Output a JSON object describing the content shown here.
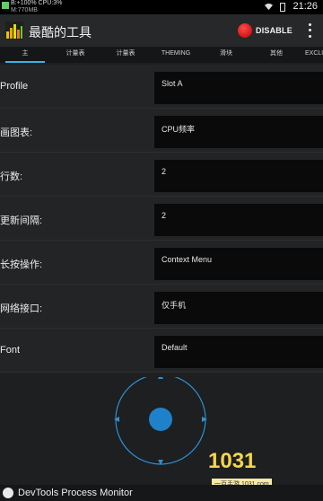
{
  "status_bar": {
    "cpu_text": "B:+100% CPU:3%",
    "mem_text": "M:770MB",
    "time": "21:26"
  },
  "action_bar": {
    "title": "最酷的工具",
    "disable_label": "DISABLE",
    "accent": "#33b5e5"
  },
  "tabs": [
    {
      "label": "主",
      "active": true
    },
    {
      "label": "计量表"
    },
    {
      "label": "计量表"
    },
    {
      "label": "THEMING"
    },
    {
      "label": "滑块"
    },
    {
      "label": "其他"
    },
    {
      "label": "EXCLUSI"
    }
  ],
  "settings": [
    {
      "label": "Profile",
      "value": "Slot A"
    },
    {
      "label": "画图表:",
      "value": "CPU频率"
    },
    {
      "label": "行数:",
      "value": "2"
    },
    {
      "label": "更新间隔:",
      "value": "2"
    },
    {
      "label": "长按操作:",
      "value": "Context Menu"
    },
    {
      "label": "网络接口:",
      "value": "仅手机"
    },
    {
      "label": "Font",
      "value": "Default"
    }
  ],
  "bottom_bar": {
    "title": "DevTools Process Monitor"
  },
  "watermark": {
    "text": "1031",
    "sub": "一百手游 1031.com"
  }
}
